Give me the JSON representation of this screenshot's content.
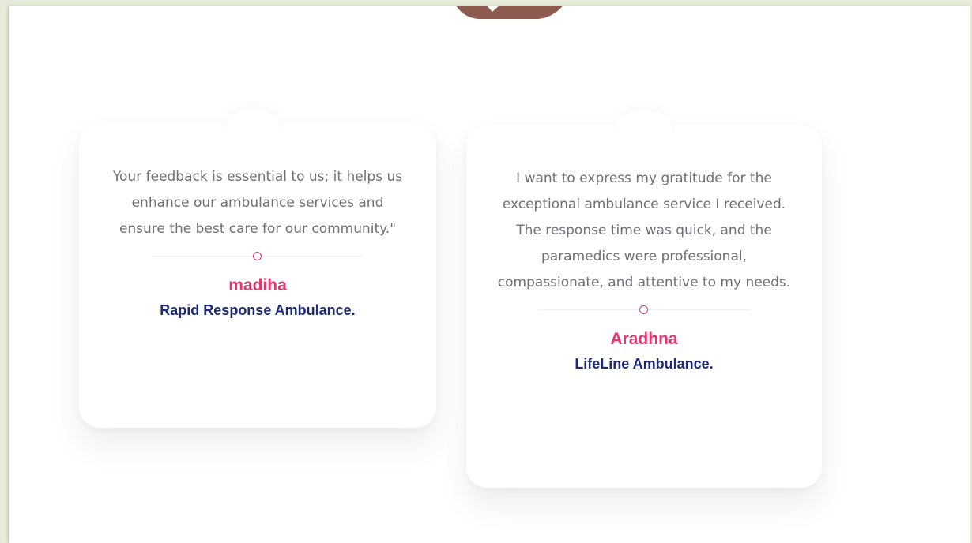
{
  "colors": {
    "accent": "#e8336e",
    "company_text": "#1c2a78",
    "quote_text": "#6f6f78",
    "page_background": "#e6ecd9",
    "top_shape": "#8c5a4f"
  },
  "testimonials": [
    {
      "quote": "Your feedback is essential to us; it helps us enhance our ambulance services and ensure the best care for our community.\"",
      "author": "madiha",
      "company": "Rapid Response Ambulance."
    },
    {
      "quote": "I want to express my gratitude for the exceptional ambulance service I received. The response time was quick, and the paramedics were professional, compassionate, and attentive to my needs.",
      "author": "Aradhna",
      "company": "LifeLine Ambulance."
    }
  ]
}
